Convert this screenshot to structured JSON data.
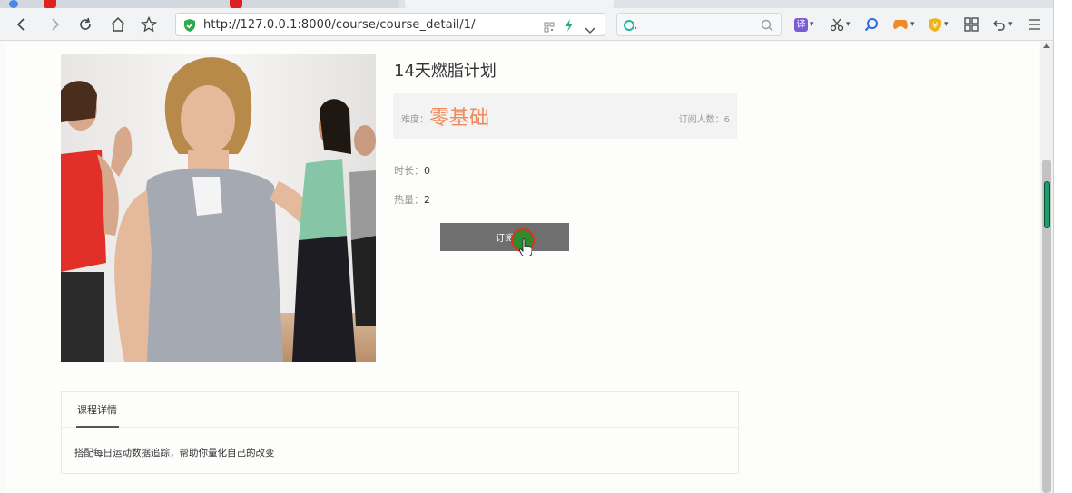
{
  "browser": {
    "url": "http://127.0.0.1:8000/course/course_detail/1/",
    "search_placeholder": ""
  },
  "course": {
    "title": "14天燃脂计划",
    "difficulty_label": "难度：",
    "difficulty_value": "零基础",
    "subscribers_text": "订阅人数：6",
    "duration_label": "时长：",
    "duration_value": "0",
    "calories_label": "热量：",
    "calories_value": "2",
    "subscribe_label": "订阅"
  },
  "detail": {
    "tab_label": "课程详情",
    "description": "搭配每日运动数据追踪，帮助你量化自己的改变"
  },
  "colors": {
    "accent": "#f08a5d",
    "button": "#6f6f6f",
    "click_ring": "#e0301e"
  }
}
